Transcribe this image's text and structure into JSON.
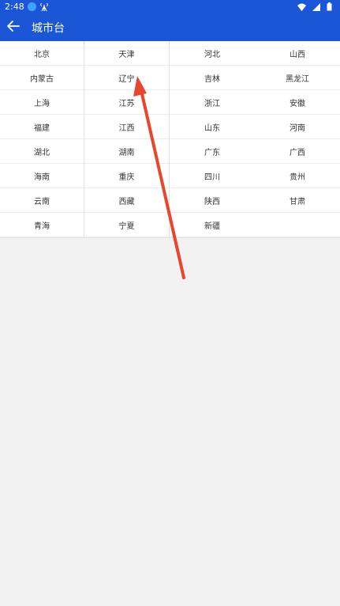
{
  "status": {
    "time": "2:48"
  },
  "appbar": {
    "title": "城市台"
  },
  "regions": [
    "北京",
    "天津",
    "河北",
    "山西",
    "内蒙古",
    "辽宁",
    "吉林",
    "黑龙江",
    "上海",
    "江苏",
    "浙江",
    "安徽",
    "福建",
    "江西",
    "山东",
    "河南",
    "湖北",
    "湖南",
    "广东",
    "广西",
    "海南",
    "重庆",
    "四川",
    "贵州",
    "云南",
    "西藏",
    "陕西",
    "甘肃",
    "青海",
    "宁夏",
    "新疆"
  ],
  "colors": {
    "primary": "#1a56d6",
    "annotation": "#e8462e"
  }
}
